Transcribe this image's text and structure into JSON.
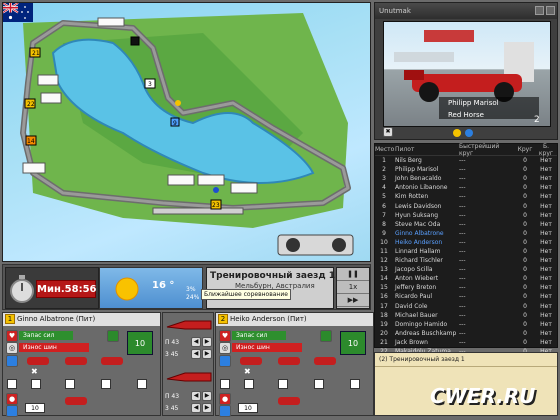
{
  "map": {
    "corner_labels": [
      "21",
      "22",
      "3",
      "4",
      "7",
      "9",
      "14",
      "15",
      "18",
      "23"
    ]
  },
  "camera": {
    "title": "Unutmak",
    "driver_name": "Philipp Marisol",
    "team_name": "Red Horse",
    "position": "2"
  },
  "timing": {
    "headers": {
      "pos": "Место",
      "name": "Пилот",
      "best": "Быстрейший круг",
      "lap": "Круг",
      "pit": "Б. круг"
    },
    "rows": [
      {
        "pos": "1",
        "name": "Nils Berg",
        "best": "---",
        "lap": "0",
        "pit": "Нет"
      },
      {
        "pos": "2",
        "name": "Philipp Marisol",
        "best": "---",
        "lap": "0",
        "pit": "Нет"
      },
      {
        "pos": "3",
        "name": "John Benacaldo",
        "best": "---",
        "lap": "0",
        "pit": "Нет"
      },
      {
        "pos": "4",
        "name": "Antonio Libanone",
        "best": "---",
        "lap": "0",
        "pit": "Нет"
      },
      {
        "pos": "5",
        "name": "Kim Rotten",
        "best": "---",
        "lap": "0",
        "pit": "Нет"
      },
      {
        "pos": "6",
        "name": "Lewis Davidson",
        "best": "---",
        "lap": "0",
        "pit": "Нет"
      },
      {
        "pos": "7",
        "name": "Hyun Suksang",
        "best": "---",
        "lap": "0",
        "pit": "Нет"
      },
      {
        "pos": "8",
        "name": "Steve Mac Oda",
        "best": "---",
        "lap": "0",
        "pit": "Нет"
      },
      {
        "pos": "9",
        "name": "Ginno Albatrone",
        "best": "---",
        "lap": "0",
        "pit": "Нет",
        "hl": true
      },
      {
        "pos": "10",
        "name": "Heiko Anderson",
        "best": "---",
        "lap": "0",
        "pit": "Нет",
        "hl": true
      },
      {
        "pos": "11",
        "name": "Linnard Hallam",
        "best": "---",
        "lap": "0",
        "pit": "Нет"
      },
      {
        "pos": "12",
        "name": "Richard Tischler",
        "best": "---",
        "lap": "0",
        "pit": "Нет"
      },
      {
        "pos": "13",
        "name": "Jacopo Scilla",
        "best": "---",
        "lap": "0",
        "pit": "Нет"
      },
      {
        "pos": "14",
        "name": "Anton Wiebert",
        "best": "---",
        "lap": "0",
        "pit": "Нет"
      },
      {
        "pos": "15",
        "name": "Jeffery Breton",
        "best": "---",
        "lap": "0",
        "pit": "Нет"
      },
      {
        "pos": "16",
        "name": "Ricardo Paul",
        "best": "---",
        "lap": "0",
        "pit": "Нет"
      },
      {
        "pos": "17",
        "name": "David Cole",
        "best": "---",
        "lap": "0",
        "pit": "Нет"
      },
      {
        "pos": "18",
        "name": "Michael Bauer",
        "best": "---",
        "lap": "0",
        "pit": "Нет"
      },
      {
        "pos": "19",
        "name": "Domingo Hamido",
        "best": "---",
        "lap": "0",
        "pit": "Нет"
      },
      {
        "pos": "20",
        "name": "Andreas Buschkamp",
        "best": "---",
        "lap": "0",
        "pit": "Нет"
      },
      {
        "pos": "21",
        "name": "Jack Brown",
        "best": "---",
        "lap": "0",
        "pit": "Нет"
      },
      {
        "pos": "22",
        "name": "Makaidolu Zatuma",
        "best": "---",
        "lap": "0",
        "pit": "Нет"
      }
    ]
  },
  "controls": {
    "time": "Мин.58:56",
    "temperature": "16 °",
    "session_title": "Тренировочный заезд 1",
    "session_location": "Мельбурн, Австралия",
    "tooltip": "Ближайшее соревнование",
    "speed_label": "1x",
    "weather_small": [
      "3%",
      "24%"
    ]
  },
  "driver1": {
    "number": "1",
    "name": "Ginno Albatrone (Пит)",
    "fuel_bar": "Запас сил",
    "wear_bar": "Износ шин",
    "fuel_value": "10",
    "setting_value": "10"
  },
  "driver2": {
    "number": "2",
    "name": "Heiko Anderson (Пит)",
    "fuel_bar": "Запас сил",
    "wear_bar": "Износ шин",
    "fuel_value": "10",
    "setting_value": "10"
  },
  "middle": {
    "pressure1": "П 43",
    "pressure2": "3 45",
    "pressure3": "П 43",
    "pressure4": "3 45"
  },
  "log": {
    "messages": [
      "(2) Тренировочный заезд 1"
    ]
  },
  "watermark": "CWER.RU"
}
